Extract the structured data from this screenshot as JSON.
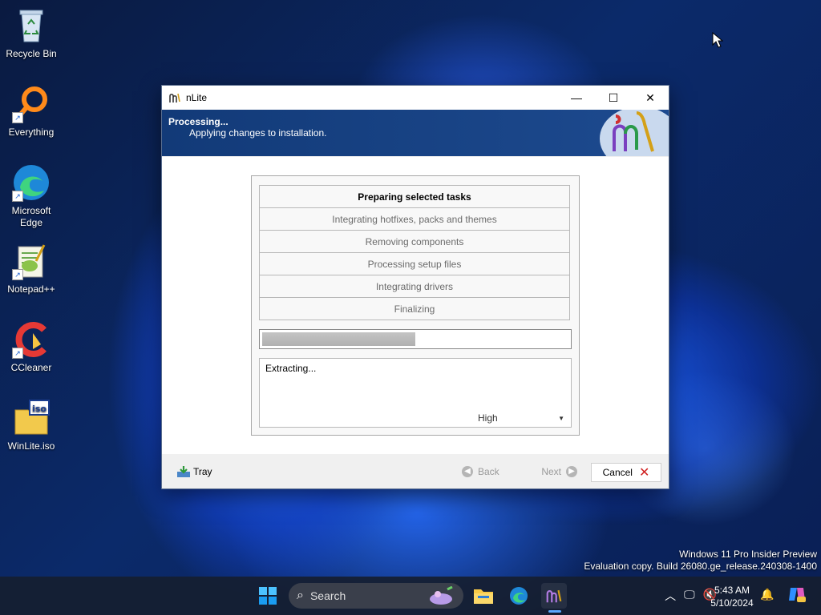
{
  "desktop": {
    "icons": [
      {
        "label": "Recycle Bin",
        "icon": "recycle-bin-icon"
      },
      {
        "label": "Everything",
        "icon": "everything-icon"
      },
      {
        "label": "Microsoft Edge",
        "icon": "edge-icon"
      },
      {
        "label": "Notepad++",
        "icon": "notepadpp-icon"
      },
      {
        "label": "CCleaner",
        "icon": "ccleaner-icon"
      },
      {
        "label": "WinLite.iso",
        "icon": "iso-file-icon"
      }
    ]
  },
  "window": {
    "title": "nLite",
    "banner": {
      "heading": "Processing...",
      "subheading": "Applying changes to installation."
    },
    "tasks": [
      {
        "label": "Preparing selected tasks",
        "active": true
      },
      {
        "label": "Integrating hotfixes, packs and themes",
        "active": false
      },
      {
        "label": "Removing components",
        "active": false
      },
      {
        "label": "Processing setup files",
        "active": false
      },
      {
        "label": "Integrating drivers",
        "active": false
      },
      {
        "label": "Finalizing",
        "active": false
      }
    ],
    "progress_fraction": 0.5,
    "log_text": "Extracting...",
    "priority": {
      "selected": "High"
    },
    "footer": {
      "tray_label": "Tray",
      "back_label": "Back",
      "next_label": "Next",
      "cancel_label": "Cancel"
    }
  },
  "watermark": {
    "line1": "Windows 11 Pro Insider Preview",
    "line2": "Evaluation copy. Build 26080.ge_release.240308-1400"
  },
  "taskbar": {
    "search_placeholder": "Search",
    "time": "5:43 AM",
    "date": "5/10/2024"
  },
  "colors": {
    "banner": "#1d4a8f",
    "accent": "#5aa9ff"
  }
}
